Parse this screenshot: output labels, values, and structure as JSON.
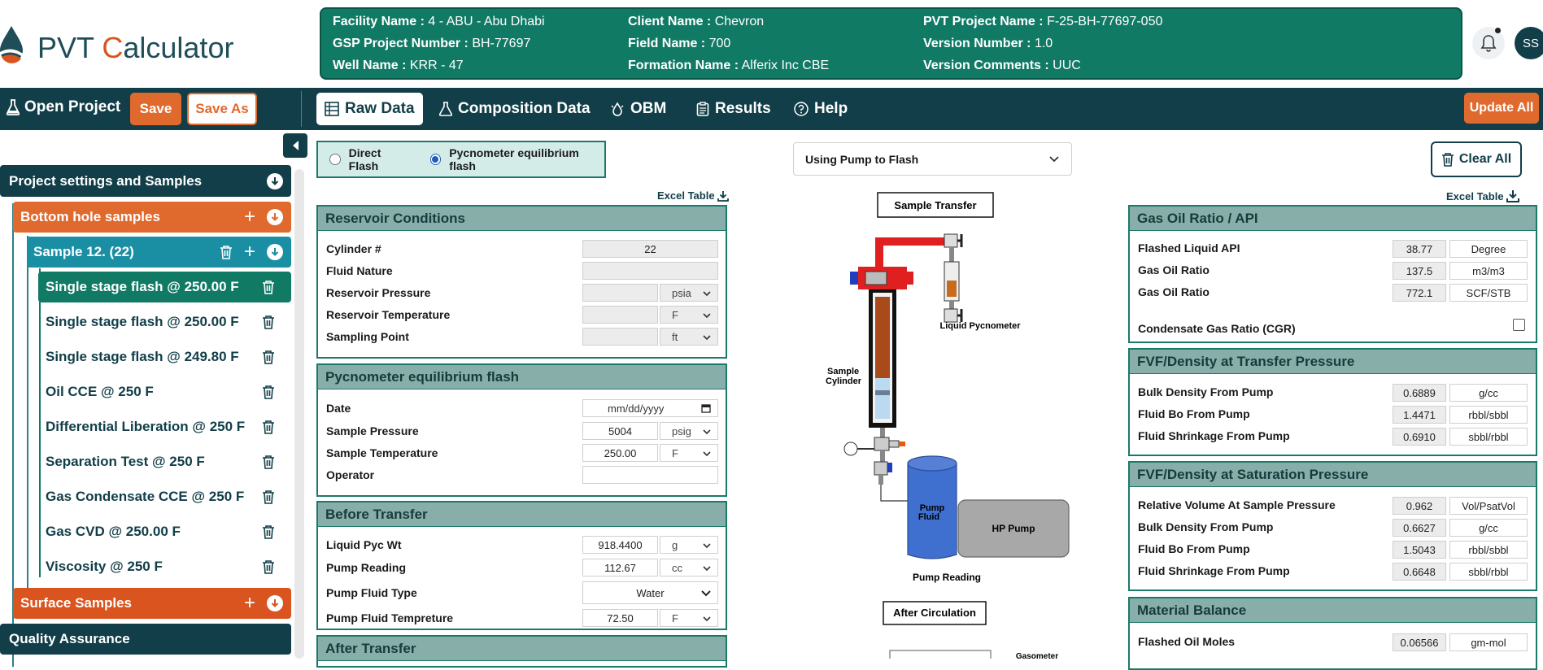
{
  "app": {
    "logo_text_main": "PVT ",
    "logo_text_accent": "C",
    "logo_text_rest": "alculator"
  },
  "project_info": {
    "facility_label": "Facility Name :",
    "facility_value": "4 - ABU - Abu Dhabi",
    "gsp_label": "GSP Project Number :",
    "gsp_value": "BH-77697",
    "well_label": "Well Name :",
    "well_value": "KRR - 47",
    "client_label": "Client Name :",
    "client_value": "Chevron",
    "field_label": "Field Name :",
    "field_value": "700",
    "formation_label": "Formation Name :",
    "formation_value": "Alferix Inc CBE",
    "pvt_label": "PVT Project Name :",
    "pvt_value": "F-25-BH-77697-050",
    "version_label": "Version Number :",
    "version_value": "1.0",
    "comments_label": "Version Comments :",
    "comments_value": "UUC"
  },
  "user": {
    "initials": "SS"
  },
  "toolbar": {
    "open_project": "Open Project",
    "save": "Save",
    "save_as": "Save As",
    "tabs": [
      {
        "label": "Raw Data",
        "icon": "table-icon"
      },
      {
        "label": "Composition Data",
        "icon": "flask-icon"
      },
      {
        "label": "OBM",
        "icon": "oil-drop-icon"
      },
      {
        "label": "Results",
        "icon": "clipboard-icon"
      },
      {
        "label": "Help",
        "icon": "question-icon"
      }
    ],
    "update_all": "Update All"
  },
  "sidebar": {
    "project_settings": "Project settings and Samples",
    "bottom_hole": "Bottom hole samples",
    "sample": "Sample 12. (22)",
    "tests": [
      "Single stage flash @ 250.00 F",
      "Single stage flash @ 250.00 F",
      "Single stage flash @ 249.80 F",
      "Oil CCE @ 250 F",
      "Differential Liberation @ 250 F",
      "Separation Test @ 250 F",
      "Gas Condensate CCE @ 250 F",
      "Gas CVD @ 250.00 F",
      "Viscosity @ 250 F"
    ],
    "surface_samples": "Surface Samples",
    "quality_assurance": "Quality Assurance"
  },
  "flash_mode": {
    "direct": "Direct Flash",
    "pycnometer": "Pycnometer equilibrium flash",
    "selected": "pycnometer"
  },
  "pump_select": {
    "value": "Using Pump to Flash"
  },
  "clear_all": "Clear All",
  "excel_table": "Excel Table",
  "reservoir": {
    "title": "Reservoir Conditions",
    "cylinder_label": "Cylinder #",
    "cylinder_value": "22",
    "fluid_label": "Fluid Nature",
    "fluid_value": "",
    "pressure_label": "Reservoir Pressure",
    "pressure_unit": "psia",
    "temperature_label": "Reservoir Temperature",
    "temperature_unit": "F",
    "sampling_label": "Sampling Point",
    "sampling_unit": "ft"
  },
  "pycno": {
    "title": "Pycnometer equilibrium flash",
    "date_label": "Date",
    "date_placeholder": "mm/dd/yyyy",
    "pressure_label": "Sample Pressure",
    "pressure_value": "5004",
    "pressure_unit": "psig",
    "temp_label": "Sample Temperature",
    "temp_value": "250.00",
    "temp_unit": "F",
    "operator_label": "Operator",
    "operator_value": ""
  },
  "before_transfer": {
    "title": "Before Transfer",
    "pyc_wt_label": "Liquid Pyc Wt",
    "pyc_wt_value": "918.4400",
    "pyc_wt_unit": "g",
    "pump_reading_label": "Pump Reading",
    "pump_reading_value": "112.67",
    "pump_reading_unit": "cc",
    "fluid_type_label": "Pump Fluid Type",
    "fluid_type_value": "Water",
    "fluid_temp_label": "Pump Fluid Tempreture",
    "fluid_temp_value": "72.50",
    "fluid_temp_unit": "F"
  },
  "after_transfer": {
    "title": "After Transfer"
  },
  "diagram": {
    "sample_transfer": "Sample Transfer",
    "liquid_pycnometer": "Liquid Pycnometer",
    "sample_cylinder_1": "Sample",
    "sample_cylinder_2": "Cylinder",
    "pump_fluid_1": "Pump",
    "pump_fluid_2": "Fluid",
    "hp_pump": "HP Pump",
    "pump_reading": "Pump Reading",
    "after_circulation": "After Circulation",
    "gasometer": "Gasometer"
  },
  "gor": {
    "title": "Gas Oil Ratio / API",
    "rows": [
      {
        "label": "Flashed Liquid API",
        "value": "38.77",
        "unit": "Degree"
      },
      {
        "label": "Gas Oil Ratio",
        "value": "137.5",
        "unit": "m3/m3"
      },
      {
        "label": "Gas Oil Ratio",
        "value": "772.1",
        "unit": "SCF/STB"
      }
    ],
    "cgr_label": "Condensate Gas Ratio (CGR)"
  },
  "fvf_transfer": {
    "title": "FVF/Density at Transfer Pressure",
    "rows": [
      {
        "label": "Bulk Density From Pump",
        "value": "0.6889",
        "unit": "g/cc"
      },
      {
        "label": "Fluid Bo From Pump",
        "value": "1.4471",
        "unit": "rbbl/sbbl"
      },
      {
        "label": "Fluid Shrinkage From Pump",
        "value": "0.6910",
        "unit": "sbbl/rbbl"
      }
    ]
  },
  "fvf_saturation": {
    "title": "FVF/Density at Saturation Pressure",
    "rows": [
      {
        "label": "Relative Volume At Sample Pressure",
        "value": "0.962",
        "unit": "Vol/PsatVol"
      },
      {
        "label": "Bulk Density From Pump",
        "value": "0.6627",
        "unit": "g/cc"
      },
      {
        "label": "Fluid Bo From Pump",
        "value": "1.5043",
        "unit": "rbbl/sbbl"
      },
      {
        "label": "Fluid Shrinkage From Pump",
        "value": "0.6648",
        "unit": "sbbl/rbbl"
      }
    ]
  },
  "material_balance": {
    "title": "Material Balance",
    "rows": [
      {
        "label": "Flashed Oil Moles",
        "value": "0.06566",
        "unit": "gm-mol"
      }
    ]
  }
}
